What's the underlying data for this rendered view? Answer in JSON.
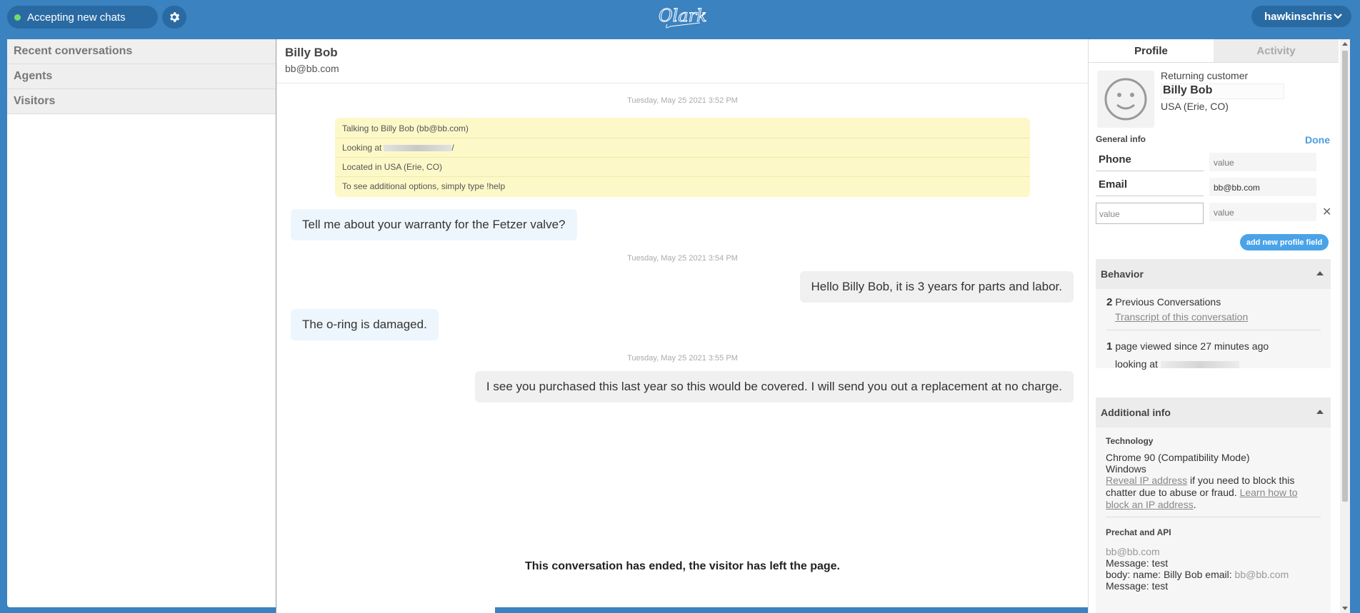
{
  "topbar": {
    "status_label": "Accepting new chats",
    "status_color": "#6fdc6f",
    "settings_icon": "gear-icon",
    "logo_text": "Olark",
    "username": "hawkinschris",
    "user_menu_icon": "chevron-down-icon"
  },
  "sidebar": {
    "items": [
      {
        "label": "Recent conversations"
      },
      {
        "label": "Agents"
      },
      {
        "label": "Visitors"
      }
    ]
  },
  "chat": {
    "header": {
      "name": "Billy Bob",
      "email": "bb@bb.com"
    },
    "timestamps": [
      "Tuesday, May 25 2021 3:52 PM",
      "Tuesday, May 25 2021 3:54 PM",
      "Tuesday, May 25 2021 3:55 PM"
    ],
    "system_lines": [
      "Talking to Billy Bob (bb@bb.com)",
      "Looking at",
      "Located in USA (Erie, CO)",
      "To see additional options, simply type !help"
    ],
    "redacted_url_suffix": "/",
    "messages": [
      {
        "from": "visitor",
        "text": "Tell me about your warranty for the Fetzer valve?"
      },
      {
        "from": "agent",
        "text": "Hello Billy Bob, it is 3 years for parts and labor."
      },
      {
        "from": "visitor",
        "text": "The o-ring is damaged."
      },
      {
        "from": "agent",
        "text": "I see you purchased this last year so this would be covered. I will send you out a replacement at no charge."
      }
    ],
    "ended_notice": "This conversation has ended, the visitor has left the page."
  },
  "panel": {
    "tabs": [
      {
        "label": "Profile",
        "active": true
      },
      {
        "label": "Activity",
        "active": false
      }
    ],
    "profile": {
      "status": "Returning customer",
      "name": "Billy Bob",
      "location": "USA (Erie, CO)",
      "avatar_icon": "smiley-face-icon"
    },
    "general_info": {
      "heading": "General info",
      "done_label": "Done",
      "fields": [
        {
          "label": "Phone",
          "value": "value",
          "is_placeholder": true
        },
        {
          "label": "Email",
          "value": "bb@bb.com",
          "is_placeholder": false
        }
      ],
      "new_field": {
        "key_placeholder": "value",
        "value_placeholder": "value"
      },
      "add_button": "add new profile field"
    },
    "behavior": {
      "heading": "Behavior",
      "previous_count": "2",
      "previous_label": "Previous Conversations",
      "transcript_link": "Transcript of this conversation",
      "pages_count": "1",
      "pages_label": "page viewed since 27 minutes ago",
      "looking_at": "looking at"
    },
    "additional": {
      "heading": "Additional info",
      "technology_heading": "Technology",
      "browser": "Chrome 90 (Compatibility Mode)",
      "os": "Windows",
      "reveal_link": "Reveal IP address",
      "reveal_text": " if you need to block this chatter due to abuse or fraud. ",
      "learn_link": "Learn how to block an IP address",
      "prechat_heading": "Prechat and API",
      "prechat_email": "bb@bb.com",
      "prechat_message1": "Message: test",
      "prechat_body_prefix": "body: name: Billy Bob email: ",
      "prechat_body_email": "bb@bb.com",
      "prechat_message2": "Message: test"
    }
  },
  "colors": {
    "brand_blue": "#3a82c0",
    "visitor_bubble": "#eef6fd",
    "agent_bubble": "#f0f0f0",
    "system_box": "#fdf8c8",
    "accent_link": "#4a9de0"
  }
}
